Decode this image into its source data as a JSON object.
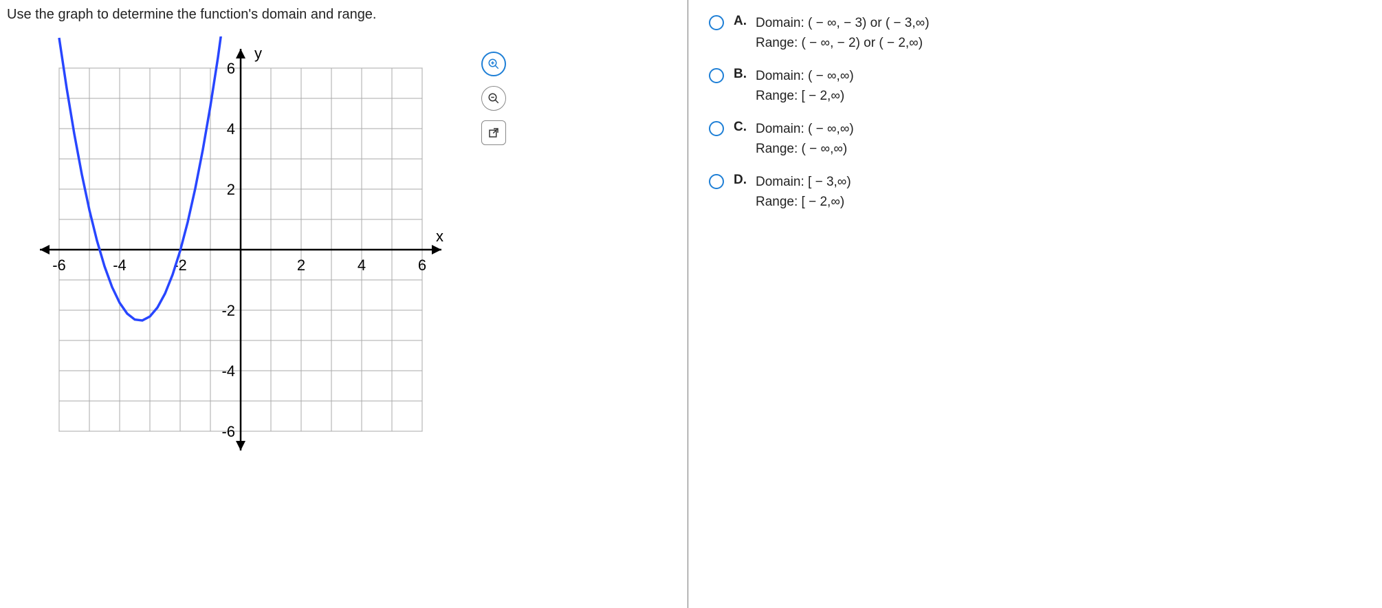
{
  "question": "Use the graph to determine the function's domain and range.",
  "axis_labels": {
    "x": "x",
    "y": "y"
  },
  "ticks": {
    "x": [
      "-6",
      "-4",
      "-2",
      "2",
      "4",
      "6"
    ],
    "y": [
      "6",
      "4",
      "2",
      "-2",
      "-4",
      "-6"
    ]
  },
  "choices": [
    {
      "label": "A.",
      "line1": "Domain: ( − ∞, − 3) or ( − 3,∞)",
      "line2": "Range: ( − ∞, − 2) or ( − 2,∞)"
    },
    {
      "label": "B.",
      "line1": "Domain: ( − ∞,∞)",
      "line2": "Range: [ − 2,∞)"
    },
    {
      "label": "C.",
      "line1": "Domain: ( − ∞,∞)",
      "line2": "Range: ( − ∞,∞)"
    },
    {
      "label": "D.",
      "line1": "Domain: [ − 3,∞)",
      "line2": "Range: [ − 2,∞)"
    }
  ],
  "chart_data": {
    "type": "line",
    "title": "",
    "xlabel": "x",
    "ylabel": "y",
    "xlim": [
      -6.5,
      6.5
    ],
    "ylim": [
      -6.5,
      6.5
    ],
    "vertex": {
      "x": -3,
      "y": -2
    },
    "function": "y = (x+3)^2 - 2",
    "series": [
      {
        "name": "parabola",
        "x": [
          -6,
          -5.5,
          -5,
          -4.5,
          -4,
          -3.5,
          -3,
          -2.5,
          -2,
          -1.5,
          -1,
          -0.5,
          0
        ],
        "y": [
          7,
          4.25,
          2,
          0.25,
          -1,
          -1.75,
          -2,
          -1.75,
          -1,
          0.25,
          2,
          4.25,
          7
        ]
      }
    ]
  }
}
